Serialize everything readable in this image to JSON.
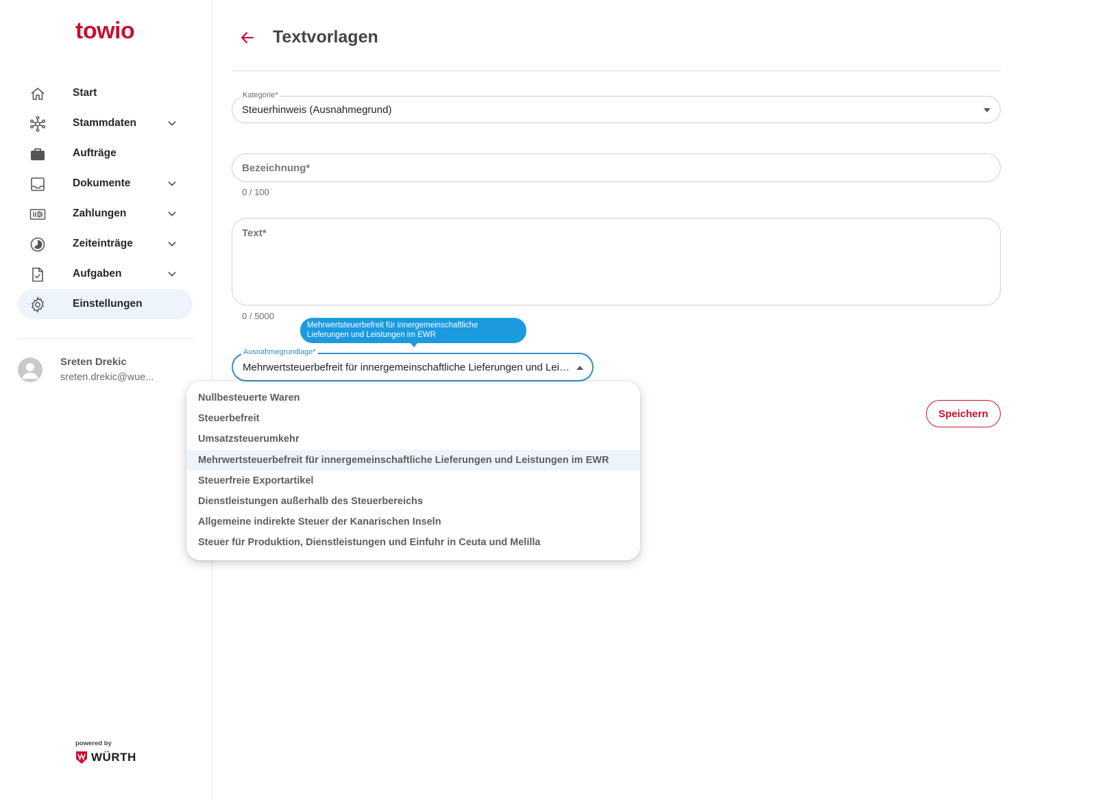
{
  "brand": {
    "logo": "towio",
    "powered_by": "powered by",
    "partner": "WÜRTH",
    "accent": "#c8102e"
  },
  "sidebar": {
    "items": [
      {
        "label": "Start",
        "icon": "home-icon",
        "expandable": false
      },
      {
        "label": "Stammdaten",
        "icon": "network-icon",
        "expandable": true
      },
      {
        "label": "Aufträge",
        "icon": "briefcase-icon",
        "expandable": false
      },
      {
        "label": "Dokumente",
        "icon": "inbox-icon",
        "expandable": true
      },
      {
        "label": "Zahlungen",
        "icon": "payments-icon",
        "expandable": true
      },
      {
        "label": "Zeiteinträge",
        "icon": "clock-icon",
        "expandable": true
      },
      {
        "label": "Aufgaben",
        "icon": "task-file-icon",
        "expandable": true
      },
      {
        "label": "Einstellungen",
        "icon": "gear-icon",
        "expandable": false,
        "active": true
      }
    ],
    "user": {
      "name": "Sreten Drekic",
      "email": "sreten.drekic@wue..."
    }
  },
  "header": {
    "title": "Textvorlagen"
  },
  "form": {
    "kategorie": {
      "label": "Kategorie*",
      "value": "Steuerhinweis (Ausnahmegrund)"
    },
    "bezeichnung": {
      "placeholder": "Bezeichnung*",
      "counter": "0 / 100"
    },
    "text": {
      "placeholder": "Text*",
      "counter": "0 / 5000"
    },
    "ausnahme": {
      "label": "Ausnahmegrundlage*",
      "value": "Mehrwertsteuerbefreit für innergemeinschaftliche Lieferungen und Leistungen im EWR",
      "tooltip": "Mehrwertsteuerbefreit für innergemeinschaftliche Lieferungen und Leistungen im EWR"
    },
    "options": [
      "Nullbesteuerte Waren",
      "Steuerbefreit",
      "Umsatzsteuerumkehr",
      "Mehrwertsteuerbefreit für innergemeinschaftliche Lieferungen und Leistungen im EWR",
      "Steuerfreie Exportartikel",
      "Dienstleistungen außerhalb des Steuerbereichs",
      "Allgemeine indirekte Steuer der Kanarischen Inseln",
      "Steuer für Produktion, Dienstleistungen und Einfuhr in Ceuta und Melilla"
    ],
    "selected_option": 3,
    "save_label": "Speichern"
  }
}
